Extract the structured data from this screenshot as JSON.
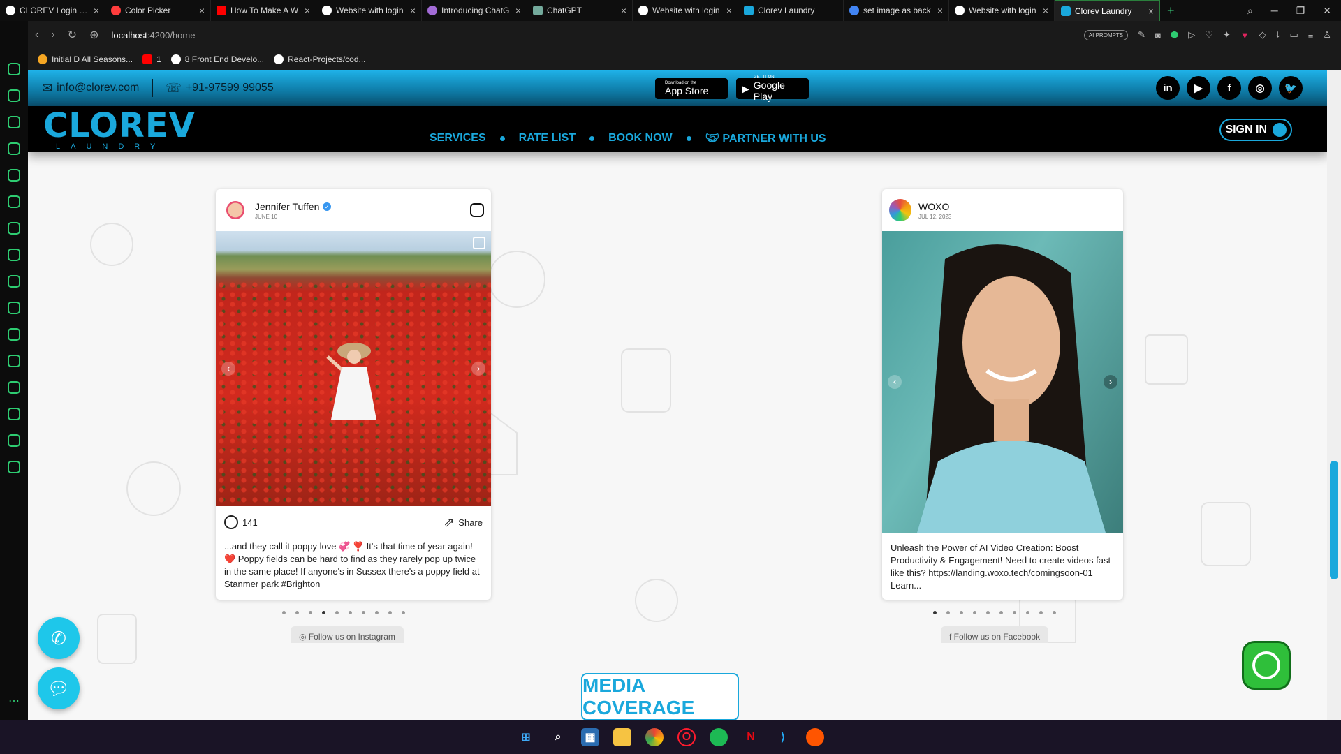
{
  "browser": {
    "tabs": [
      {
        "title": "CLOREV Login For",
        "color": "#ffffff"
      },
      {
        "title": "Color Picker",
        "color": "#ff3d3d"
      },
      {
        "title": "How To Make A W",
        "color": "#ff0000"
      },
      {
        "title": "Website with login",
        "color": "#ffffff"
      },
      {
        "title": "Introducing ChatG",
        "color": "#a26bd6"
      },
      {
        "title": "ChatGPT",
        "color": "#74aa9c"
      },
      {
        "title": "Website with login",
        "color": "#ffffff"
      },
      {
        "title": "Clorev Laundry",
        "color": "#1aa8dc"
      },
      {
        "title": "set image as back",
        "color": "#4285f4"
      },
      {
        "title": "Website with login",
        "color": "#ffffff"
      },
      {
        "title": "Clorev Laundry",
        "color": "#1aa8dc"
      }
    ],
    "url_host": "localhost",
    "url_path": ":4200/home",
    "ai_prompts": "AI PROMPTS",
    "bookmarks": [
      {
        "label": "Initial D All Seasons...",
        "color": "#f5a623"
      },
      {
        "label": "1",
        "color": "#ff0000"
      },
      {
        "label": "8 Front End Develo...",
        "color": "#ffffff"
      },
      {
        "label": "React-Projects/cod...",
        "color": "#ffffff"
      }
    ]
  },
  "site": {
    "email": "info@clorev.com",
    "phone": "+91-97599 99055",
    "app_store_small": "Download on the",
    "app_store": "App Store",
    "google_play_small": "GET IT ON",
    "google_play": "Google Play",
    "socials": [
      "in",
      "▶",
      "f",
      "◎",
      "🐦"
    ],
    "logo_main": "CLOREV",
    "logo_sub": "LAUNDRY",
    "menu": [
      "SERVICES",
      "RATE LIST",
      "BOOK NOW",
      "PARTNER WITH US"
    ],
    "sign_in": "SIGN IN",
    "brand_color": "#1aa8dc"
  },
  "instagram_card": {
    "name": "Jennifer Tuffen",
    "date": "JUNE 10",
    "comments": "141",
    "share": "Share",
    "caption": "...and they call it poppy love 💞 ❣️ It's that time of year again! ❤️ Poppy fields can be hard to find as they rarely pop up twice in the same place! If anyone's in Sussex there's a poppy field at Stanmer park #Brighton",
    "follow": "Follow us on Instagram",
    "dots": 10,
    "active_dot": 3
  },
  "facebook_card": {
    "name": "WOXO",
    "date": "JUL 12, 2023",
    "caption": "Unleash the Power of AI Video Creation: Boost Productivity & Engagement! Need to create videos fast like this? https://landing.woxo.tech/comingsoon-01 Learn...",
    "follow": "Follow us on Facebook",
    "dots": 10,
    "active_dot": 1
  },
  "media_coverage": "MEDIA COVERAGE"
}
